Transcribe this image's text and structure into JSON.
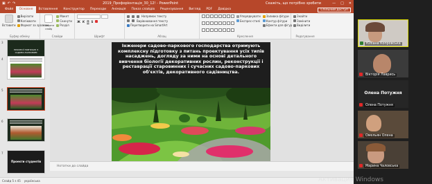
{
  "titlebar": {
    "title": "2019_Профорієнтація_30_12! - PowerPoint",
    "search": "Скажіть, що потрібно зробити",
    "controls": [
      "—",
      "□",
      "✕"
    ]
  },
  "menu": {
    "tabs": [
      "Файл",
      "Основне",
      "Вставлення",
      "Конструктор",
      "Переходи",
      "Анімація",
      "Показ слайдів",
      "Рецензування",
      "Вигляд",
      "PDF",
      "Довідка"
    ],
    "active_index": 1,
    "share": "Спільний доступ"
  },
  "ribbon": {
    "groups": [
      {
        "label": "Буфер обміну",
        "commands": [
          "Вставити",
          "Вирізати",
          "Копіювати",
          "Формат за зразком"
        ]
      },
      {
        "label": "Слайди",
        "commands": [
          "Створити слайд",
          "Макет",
          "Скинути",
          "Розділ"
        ]
      },
      {
        "label": "Шрифт",
        "commands": [
          "Ж",
          "К",
          "П",
          "S"
        ]
      },
      {
        "label": "Абзац",
        "commands": [
          "Напрямок тексту",
          "Вирівнювання тексту",
          "Перетворити на SmartArt"
        ]
      },
      {
        "label": "Креслення",
        "commands": [
          "Упорядкувати",
          "Експрес-стилі",
          "Заливка фігури",
          "Контур фігури",
          "Ефекти для фігур"
        ]
      },
      {
        "label": "Редагування",
        "commands": [
          "Знайти",
          "Замінити",
          "Виділити"
        ]
      }
    ]
  },
  "thumbs": {
    "items": [
      {
        "num": "3",
        "label": "ПРОФЕСІЇ ПОВ'ЯЗАНІ З САДОВО-ПАРКОВИМ",
        "selected": false
      },
      {
        "num": "4",
        "label": "",
        "selected": false
      },
      {
        "num": "5",
        "label": "",
        "selected": true
      },
      {
        "num": "6",
        "label": "",
        "selected": false
      },
      {
        "num": "7",
        "label": "Проекти студентів",
        "selected": false
      }
    ]
  },
  "slide": {
    "text": "Інженери садово-паркового господарства отримують комплексну підготовку з питань проектування усіх типів насаджень, догляду за ними на основі детального вивчення біології декоративних рослин, реконструкції і реставрації старовинних і сучасних садово-паркових об'єктів, декоративного садівництва."
  },
  "notes": {
    "placeholder": "Нотатки до слайда"
  },
  "status": {
    "slide": "Слайд 5 з 45",
    "language": "українська"
  },
  "participants": [
    {
      "name": "Юліана Копровська",
      "kind": "video",
      "active": true,
      "mic_muted": false
    },
    {
      "name": "Вікторія Лаврись",
      "kind": "video",
      "active": false,
      "mic_muted": true
    },
    {
      "name": "Олена Потужня",
      "kind": "name",
      "big": "Олена Потужня",
      "active": false,
      "mic_muted": true
    },
    {
      "name": "Омельян Олена",
      "kind": "video",
      "active": false,
      "mic_muted": true
    },
    {
      "name": "Марина Чаловська",
      "kind": "video",
      "active": false,
      "mic_muted": true
    }
  ],
  "watermark": "Активация Windows",
  "colors": {
    "accent": "#b7472a",
    "selection": "#d24726",
    "active_speaker": "#dcdc00",
    "muted": "#e02828"
  }
}
